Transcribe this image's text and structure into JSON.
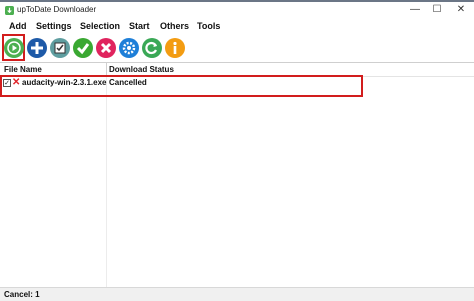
{
  "window": {
    "title": "upToDate Downloader",
    "minimize_glyph": "—",
    "maximize_glyph": "☐",
    "close_glyph": "✕"
  },
  "menu": {
    "items": [
      "Add",
      "Settings",
      "Selection",
      "Start",
      "Others",
      "Tools"
    ]
  },
  "toolbar": {
    "buttons": [
      {
        "icon": "play-icon",
        "color": "#4caf50"
      },
      {
        "icon": "add-icon",
        "color": "#1e5aa8"
      },
      {
        "icon": "select-all-icon",
        "color": "#5f9ea0"
      },
      {
        "icon": "check-icon",
        "color": "#3aa832"
      },
      {
        "icon": "remove-icon",
        "color": "#e0245e"
      },
      {
        "icon": "settings-icon",
        "color": "#1e7fd8"
      },
      {
        "icon": "refresh-icon",
        "color": "#3aa856"
      },
      {
        "icon": "info-icon",
        "color": "#f39c12"
      }
    ]
  },
  "table": {
    "columns": [
      "File Name",
      "Download Status"
    ],
    "rows": [
      {
        "checked": true,
        "file": "audacity-win-2.3.1.exe",
        "status": "Cancelled",
        "status_icon": "cancel-x-icon"
      }
    ]
  },
  "statusbar": {
    "text": "Cancel: 1"
  },
  "colors": {
    "highlight": "#d21d1d"
  }
}
